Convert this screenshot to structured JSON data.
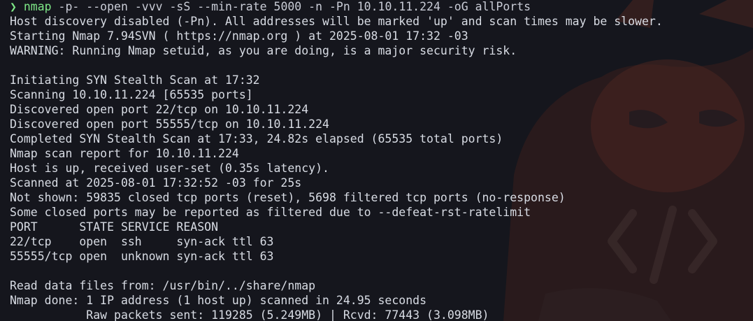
{
  "theme": {
    "background": "#15161d",
    "foreground": "#d8dce4",
    "prompt_color": "#7ee787",
    "wallpaper_color": "#5a2a1e",
    "wallpaper_icon": "tiger-mascot-with-code-icon"
  },
  "prompt": {
    "symbol": "❯",
    "command": "nmap",
    "arguments": " -p- --open -vvv -sS --min-rate 5000 -n -Pn 10.10.11.224 -oG allPorts"
  },
  "output": [
    "Host discovery disabled (-Pn). All addresses will be marked 'up' and scan times may be slower.",
    "Starting Nmap 7.94SVN ( https://nmap.org ) at 2025-08-01 17:32 -03",
    "WARNING: Running Nmap setuid, as you are doing, is a major security risk.",
    "",
    "Initiating SYN Stealth Scan at 17:32",
    "Scanning 10.10.11.224 [65535 ports]",
    "Discovered open port 22/tcp on 10.10.11.224",
    "Discovered open port 55555/tcp on 10.10.11.224",
    "Completed SYN Stealth Scan at 17:33, 24.82s elapsed (65535 total ports)",
    "Nmap scan report for 10.10.11.224",
    "Host is up, received user-set (0.35s latency).",
    "Scanned at 2025-08-01 17:32:52 -03 for 25s",
    "Not shown: 59835 closed tcp ports (reset), 5698 filtered tcp ports (no-response)",
    "Some closed ports may be reported as filtered due to --defeat-rst-ratelimit",
    "PORT      STATE SERVICE REASON",
    "22/tcp    open  ssh     syn-ack ttl 63",
    "55555/tcp open  unknown syn-ack ttl 63",
    "",
    "Read data files from: /usr/bin/../share/nmap",
    "Nmap done: 1 IP address (1 host up) scanned in 24.95 seconds",
    "           Raw packets sent: 119285 (5.249MB) | Rcvd: 77443 (3.098MB)"
  ]
}
